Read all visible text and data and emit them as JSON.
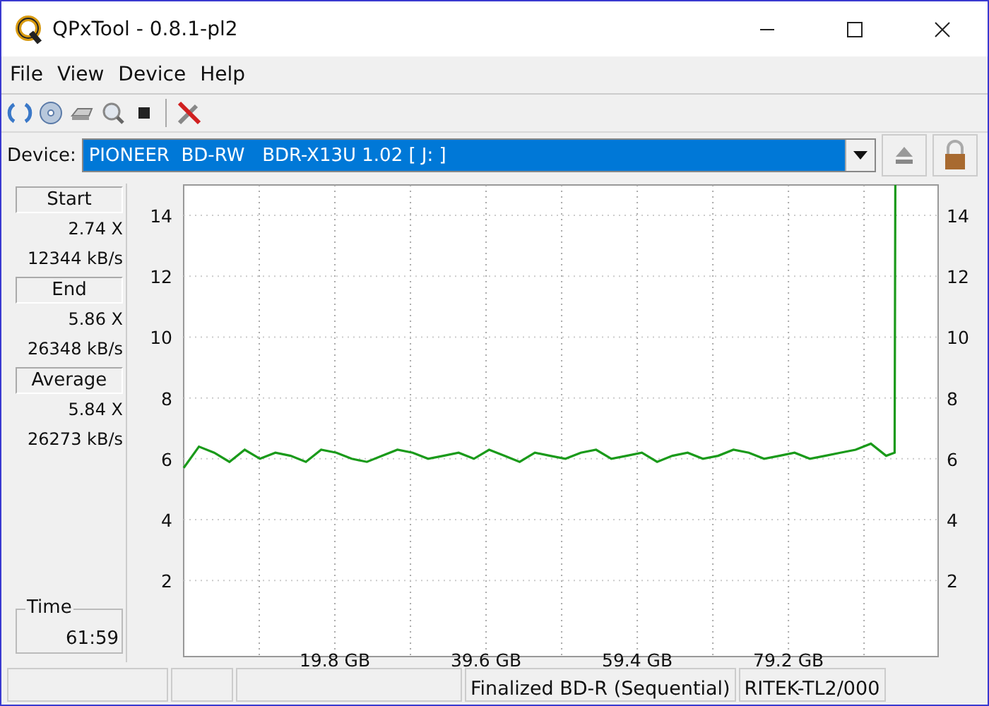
{
  "window": {
    "title": "QPxTool - 0.8.1-pl2"
  },
  "menu": [
    "File",
    "View",
    "Device",
    "Help"
  ],
  "device": {
    "label": "Device:",
    "value": "PIONEER  BD-RW   BDR-X13U 1.02 [ J: ]"
  },
  "stats": [
    {
      "label": "Start",
      "lines": [
        "2.74 X",
        "12344 kB/s"
      ]
    },
    {
      "label": "End",
      "lines": [
        "5.86 X",
        "26348 kB/s"
      ]
    },
    {
      "label": "Average",
      "lines": [
        "5.84 X",
        "26273 kB/s"
      ]
    }
  ],
  "time": {
    "label": "Time",
    "value": "61:59"
  },
  "chart_data": {
    "type": "line",
    "grid": true,
    "xlim": [
      0,
      98.8
    ],
    "ylim": [
      -0.5,
      15
    ],
    "xticks": [
      {
        "value": 19.8,
        "label": "19.8 GB"
      },
      {
        "value": 39.6,
        "label": "39.6 GB"
      },
      {
        "value": 59.4,
        "label": "59.4 GB"
      },
      {
        "value": 79.2,
        "label": "79.2 GB"
      }
    ],
    "yticks": [
      2,
      4,
      6,
      8,
      10,
      12,
      14
    ],
    "y2ticks": [
      2,
      4,
      6,
      8,
      10,
      12,
      14
    ],
    "y2lim": [
      -0.5,
      15
    ],
    "x": [
      0,
      2,
      4,
      6,
      8,
      10,
      12,
      14,
      16,
      18,
      20,
      22,
      24,
      26,
      28,
      30,
      32,
      34,
      36,
      38,
      40,
      42,
      44,
      46,
      48,
      50,
      52,
      54,
      56,
      58,
      60,
      62,
      64,
      66,
      68,
      70,
      72,
      74,
      76,
      78,
      80,
      82,
      84,
      86,
      88,
      90,
      92,
      93.1,
      93.2
    ],
    "series": [
      {
        "color": "#1a9a1a",
        "values": [
          5.7,
          6.4,
          6.2,
          5.9,
          6.3,
          6.0,
          6.2,
          6.1,
          5.9,
          6.3,
          6.2,
          6.0,
          5.9,
          6.1,
          6.3,
          6.2,
          6.0,
          6.1,
          6.2,
          6.0,
          6.3,
          6.1,
          5.9,
          6.2,
          6.1,
          6.0,
          6.2,
          6.3,
          6.0,
          6.1,
          6.2,
          5.9,
          6.1,
          6.2,
          6.0,
          6.1,
          6.3,
          6.2,
          6.0,
          6.1,
          6.2,
          6.0,
          6.1,
          6.2,
          6.3,
          6.5,
          6.1,
          6.2,
          15
        ]
      }
    ]
  },
  "status_bar": [
    "Finalized BD-R (Sequential)",
    "RITEK-TL2/000"
  ]
}
